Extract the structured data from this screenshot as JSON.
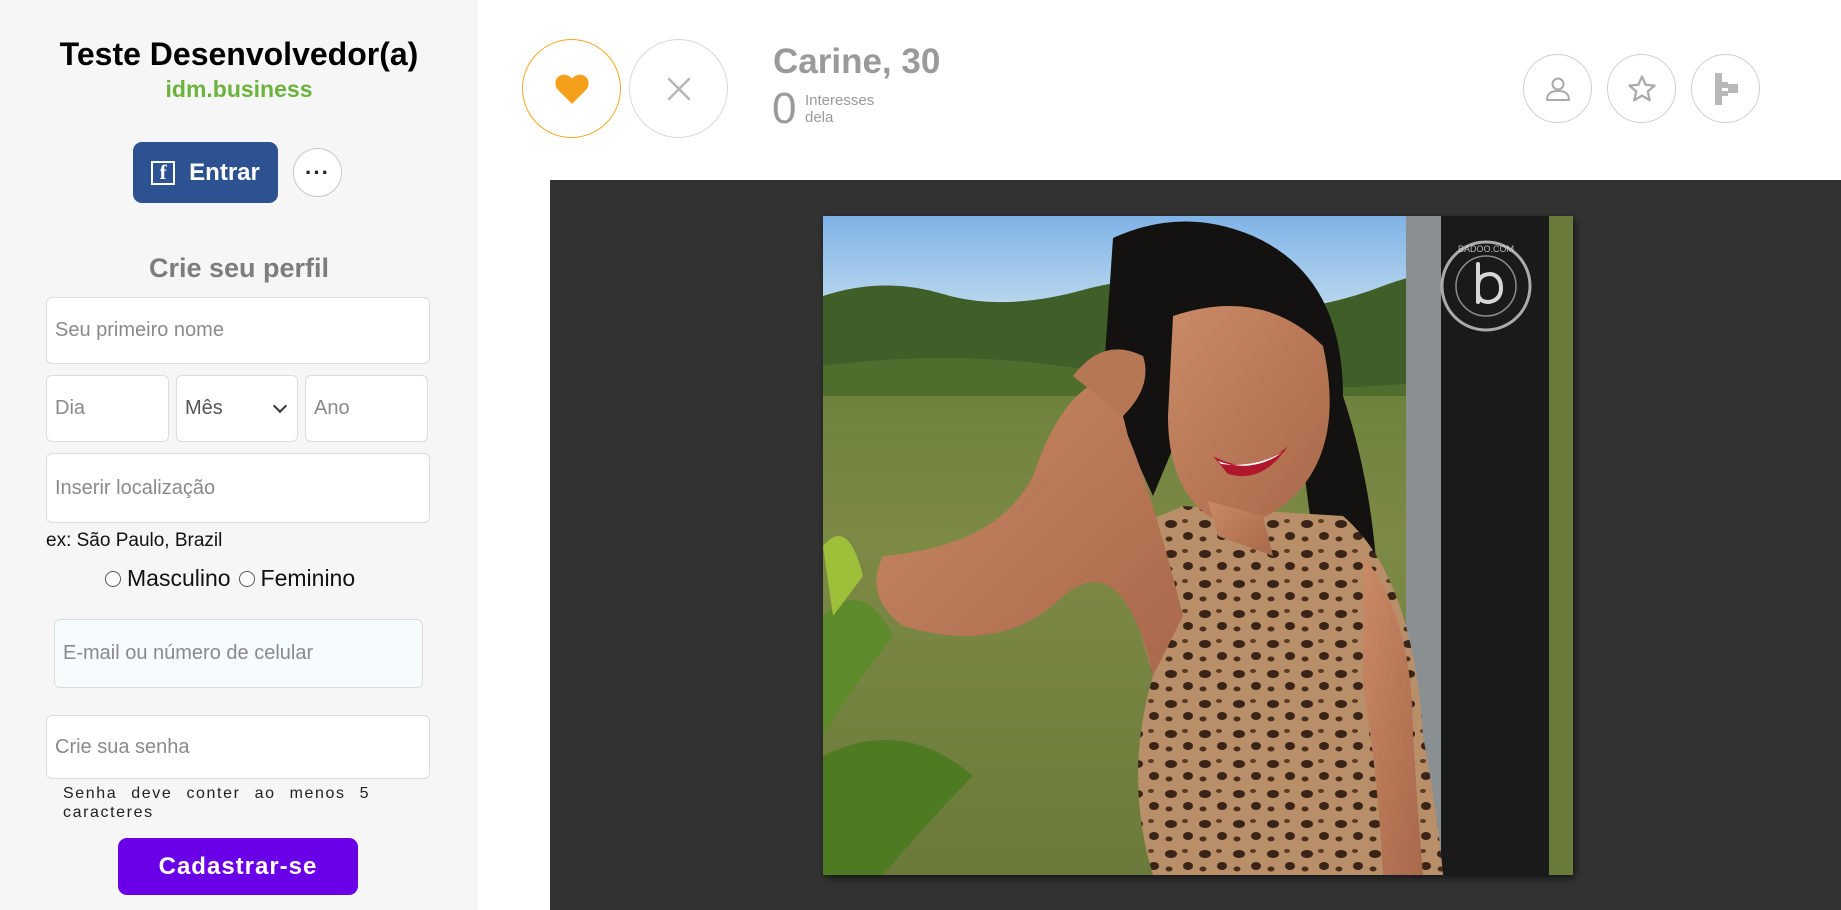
{
  "sidebar": {
    "title": "Teste Desenvolvedor(a)",
    "subtitle": "idm.business",
    "facebook_button_label": "Entrar",
    "more_button_label": "···",
    "form_heading": "Crie seu perfil",
    "first_name_placeholder": "Seu primeiro nome",
    "day_placeholder": "Dia",
    "month_selected": "Mês",
    "year_placeholder": "Ano",
    "location_placeholder": "Inserir localização",
    "location_hint": "ex: São Paulo, Brazil",
    "gender_options": [
      "Masculino",
      "Feminino"
    ],
    "email_placeholder": "E-mail ou número de celular",
    "password_placeholder": "Crie sua senha",
    "password_note": "Senha deve conter ao menos 5 caracteres",
    "signup_button_label": "Cadastrar-se"
  },
  "profile": {
    "name_age": "Carine, 30",
    "interest_count": "0",
    "interest_label": "Interesses dela",
    "photo_watermark": "BADOO.COM"
  },
  "colors": {
    "brand_green": "#6cb33e",
    "facebook_blue": "#2d5291",
    "signup_purple": "#6a00e8",
    "like_orange": "#f5a623",
    "photo_background": "#333333"
  },
  "icons": {
    "like": "heart-icon",
    "pass": "close-icon",
    "profile": "user-icon",
    "favorite": "star-icon",
    "more": "hierarchy-icon"
  }
}
